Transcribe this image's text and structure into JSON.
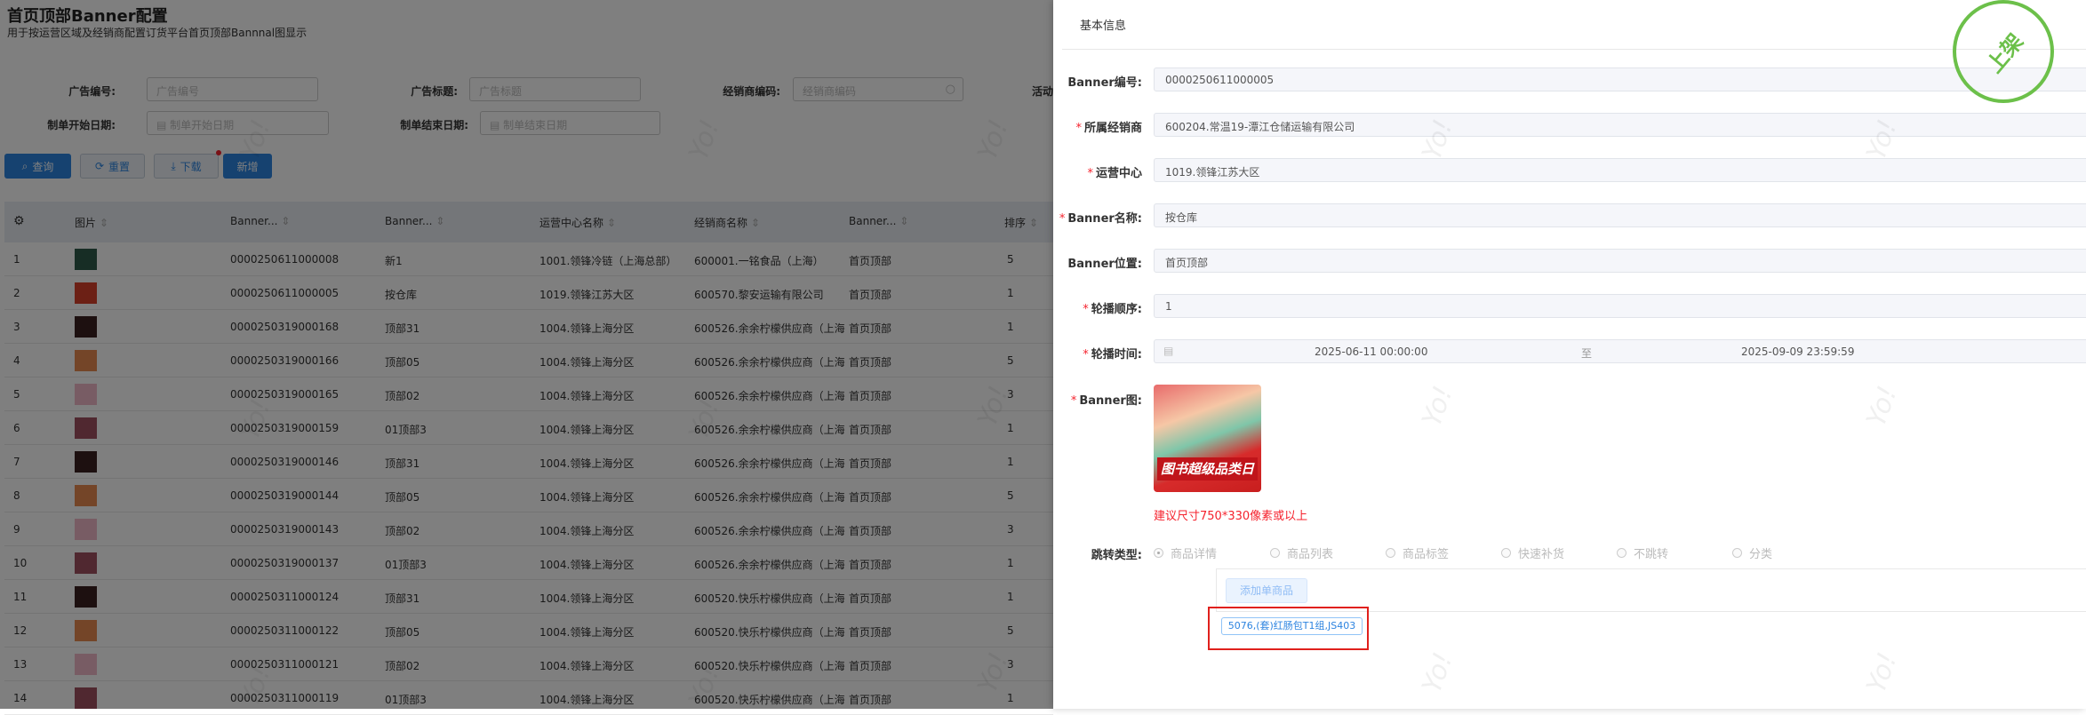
{
  "page": {
    "title": "首页顶部Banner配置",
    "subtitle": "用于按运营区域及经销商配置订货平台首页顶部Bannnal图显示"
  },
  "filters": {
    "ad_no": {
      "label": "广告编号:",
      "placeholder": "广告编号"
    },
    "ad_title": {
      "label": "广告标题:",
      "placeholder": "广告标题"
    },
    "dealer_code": {
      "label": "经销商编码:",
      "placeholder": "经销商编码"
    },
    "activity_label": "活动",
    "start_date": {
      "label": "制单开始日期:",
      "placeholder": "制单开始日期"
    },
    "end_date": {
      "label": "制单结束日期:",
      "placeholder": "制单结束日期"
    }
  },
  "toolbar": {
    "query": "查询",
    "reset": "重置",
    "download": "下载",
    "add": "新增"
  },
  "table": {
    "columns": [
      "图片",
      "Banner...",
      "Banner...",
      "运营中心名称",
      "经销商名称",
      "Banner...",
      "排序"
    ],
    "rows": [
      {
        "idx": "1",
        "id": "0000250611000008",
        "name": "新1",
        "center": "1001.领锋冷链（上海总部）",
        "dealer": "600001.一铭食品（上海）",
        "pos": "首页顶部",
        "sort": "5",
        "thumb": "#2f5a4a"
      },
      {
        "idx": "2",
        "id": "0000250611000005",
        "name": "按仓库",
        "center": "1019.领锋江苏大区",
        "dealer": "600570.黎安运输有限公司",
        "pos": "首页顶部",
        "sort": "1",
        "thumb": "#d9402a"
      },
      {
        "idx": "3",
        "id": "0000250319000168",
        "name": "顶部31",
        "center": "1004.领锋上海分区",
        "dealer": "600526.余余柠檬供应商（上海",
        "pos": "首页顶部",
        "sort": "1",
        "thumb": "#3a2020"
      },
      {
        "idx": "4",
        "id": "0000250319000166",
        "name": "顶部05",
        "center": "1004.领锋上海分区",
        "dealer": "600526.余余柠檬供应商（上海",
        "pos": "首页顶部",
        "sort": "5",
        "thumb": "#e88a50"
      },
      {
        "idx": "5",
        "id": "0000250319000165",
        "name": "顶部02",
        "center": "1004.领锋上海分区",
        "dealer": "600526.余余柠檬供应商（上海",
        "pos": "首页顶部",
        "sort": "3",
        "thumb": "#f0b8c8"
      },
      {
        "idx": "6",
        "id": "0000250319000159",
        "name": "01顶部3",
        "center": "1004.领锋上海分区",
        "dealer": "600526.余余柠檬供应商（上海",
        "pos": "首页顶部",
        "sort": "1",
        "thumb": "#a05060"
      },
      {
        "idx": "7",
        "id": "0000250319000146",
        "name": "顶部31",
        "center": "1004.领锋上海分区",
        "dealer": "600526.余余柠檬供应商（上海",
        "pos": "首页顶部",
        "sort": "1",
        "thumb": "#3a2020"
      },
      {
        "idx": "8",
        "id": "0000250319000144",
        "name": "顶部05",
        "center": "1004.领锋上海分区",
        "dealer": "600526.余余柠檬供应商（上海",
        "pos": "首页顶部",
        "sort": "5",
        "thumb": "#e88a50"
      },
      {
        "idx": "9",
        "id": "0000250319000143",
        "name": "顶部02",
        "center": "1004.领锋上海分区",
        "dealer": "600526.余余柠檬供应商（上海",
        "pos": "首页顶部",
        "sort": "3",
        "thumb": "#f0b8c8"
      },
      {
        "idx": "10",
        "id": "0000250319000137",
        "name": "01顶部3",
        "center": "1004.领锋上海分区",
        "dealer": "600526.余余柠檬供应商（上海",
        "pos": "首页顶部",
        "sort": "1",
        "thumb": "#a05060"
      },
      {
        "idx": "11",
        "id": "0000250311000124",
        "name": "顶部31",
        "center": "1004.领锋上海分区",
        "dealer": "600520.快乐柠檬供应商（上海",
        "pos": "首页顶部",
        "sort": "1",
        "thumb": "#3a2020"
      },
      {
        "idx": "12",
        "id": "0000250311000122",
        "name": "顶部05",
        "center": "1004.领锋上海分区",
        "dealer": "600520.快乐柠檬供应商（上海",
        "pos": "首页顶部",
        "sort": "5",
        "thumb": "#e88a50"
      },
      {
        "idx": "13",
        "id": "0000250311000121",
        "name": "顶部02",
        "center": "1004.领锋上海分区",
        "dealer": "600520.快乐柠檬供应商（上海",
        "pos": "首页顶部",
        "sort": "3",
        "thumb": "#f0b8c8"
      },
      {
        "idx": "14",
        "id": "0000250311000119",
        "name": "01顶部3",
        "center": "1004.领锋上海分区",
        "dealer": "600520.快乐柠檬供应商（上海",
        "pos": "首页顶部",
        "sort": "1",
        "thumb": "#a05060"
      }
    ]
  },
  "drawer": {
    "section": "基本信息",
    "stamp": "上架",
    "stamp_color": "#6cc04a",
    "fields": {
      "banner_no": {
        "label": "Banner编号:",
        "value": "0000250611000005"
      },
      "dealer": {
        "label": "所属经销商",
        "value": "600204.常温19-潭江仓储运输有限公司"
      },
      "center": {
        "label": "运营中心",
        "value": "1019.领锋江苏大区"
      },
      "name": {
        "label": "Banner名称:",
        "value": "按仓库"
      },
      "position": {
        "label": "Banner位置:",
        "value": "首页顶部"
      },
      "order": {
        "label": "轮播顺序:",
        "value": "1"
      },
      "time": {
        "label": "轮播时间:",
        "start": "2025-06-11 00:00:00",
        "sep": "至",
        "end": "2025-09-09 23:59:59"
      },
      "image": {
        "label": "Banner图:",
        "image_text": "图书超级品类日",
        "hint": "建议尺寸750*330像素或以上"
      },
      "jump": {
        "label": "跳转类型:",
        "options": [
          "商品详情",
          "商品列表",
          "商品标签",
          "快速补货",
          "不跳转",
          "分类"
        ],
        "selected": "商品详情"
      },
      "add_product": "添加单商品",
      "product_tag": "5076,(套)红肠包T1组,JS403"
    }
  },
  "watermark": "Yo!"
}
